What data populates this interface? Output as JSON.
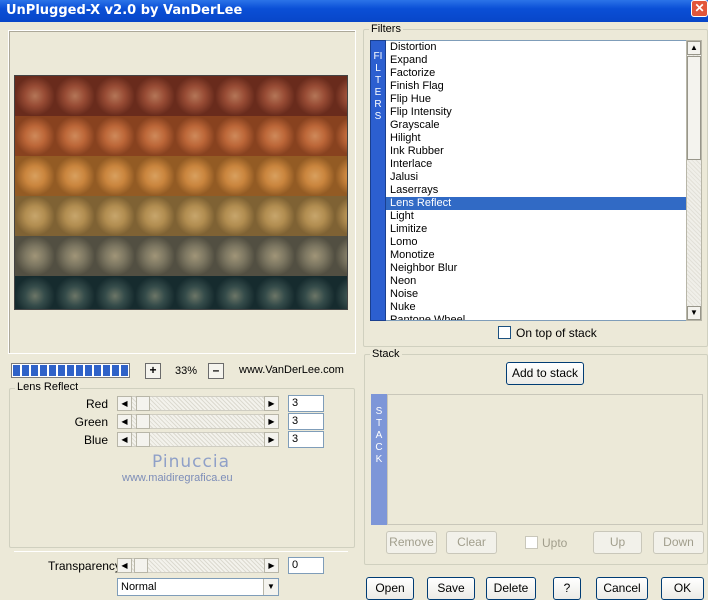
{
  "window": {
    "title": "UnPlugged-X v2.0 by VanDerLee",
    "close_glyph": "✕"
  },
  "preview": {
    "bands": [
      "#8c3a26",
      "#b5582a",
      "#c47a30",
      "#a98345",
      "#6e6a58",
      "#1e3a3e"
    ]
  },
  "zoom": {
    "plus": "+",
    "value": "33%",
    "minus": "–",
    "progress_segments": 13
  },
  "website": "www.VanDerLee.com",
  "settings": {
    "group_title": "Lens Reflect",
    "sliders": [
      {
        "label": "Red",
        "value": "3"
      },
      {
        "label": "Green",
        "value": "3"
      },
      {
        "label": "Blue",
        "value": "3"
      }
    ],
    "watermark_name": "Pinuccia",
    "watermark_url": "www.maidiregrafica.eu",
    "transparency_label": "Transparency",
    "transparency_value": "0",
    "blend_mode": "Normal"
  },
  "filters": {
    "title": "Filters",
    "vertical_label": "FILTERS",
    "items": [
      "Distortion",
      "Expand",
      "Factorize",
      "Finish Flag",
      "Flip Hue",
      "Flip Intensity",
      "Grayscale",
      "Hilight",
      "Ink Rubber",
      "Interlace",
      "Jalusi",
      "Laserrays",
      "Lens Reflect",
      "Light",
      "Limitize",
      "Lomo",
      "Monotize",
      "Neighbor Blur",
      "Neon",
      "Noise",
      "Nuke",
      "Pantone Wheel"
    ],
    "selected": "Lens Reflect",
    "on_top_label": "On top of stack"
  },
  "stack": {
    "title": "Stack",
    "add_button": "Add to stack",
    "vertical_label": "STACK",
    "remove": "Remove",
    "clear": "Clear",
    "upto": "Upto",
    "up": "Up",
    "down": "Down"
  },
  "footer": {
    "open": "Open",
    "save": "Save",
    "delete": "Delete",
    "help": "?",
    "cancel": "Cancel",
    "ok": "OK"
  },
  "colors": {
    "accent": "#316ac5",
    "titlebar": "#0a4fd6"
  }
}
